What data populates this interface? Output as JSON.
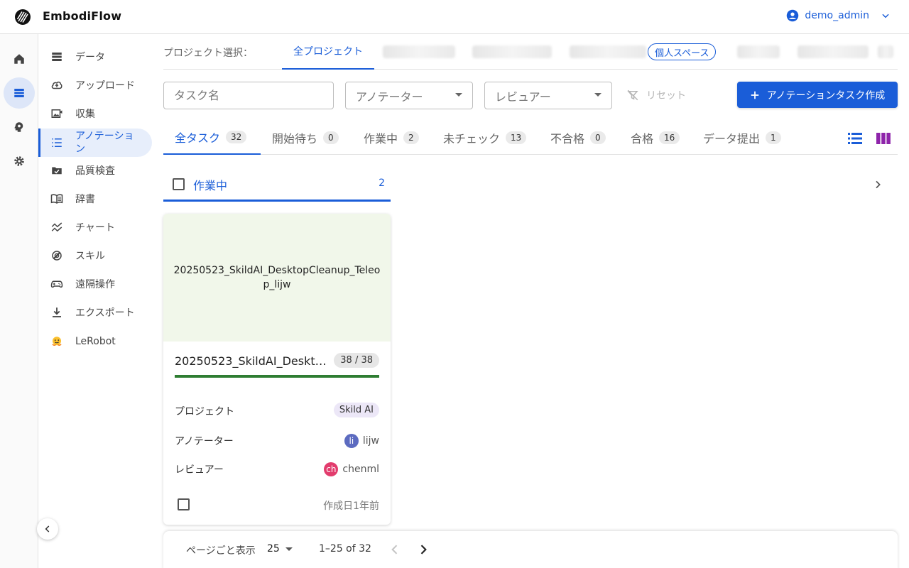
{
  "header": {
    "brand": "EmbodiFlow",
    "user": "demo_admin"
  },
  "sidebar": {
    "items": [
      {
        "label": "データ",
        "icon": "database-icon"
      },
      {
        "label": "アップロード",
        "icon": "cloud-upload-icon"
      },
      {
        "label": "収集",
        "icon": "camera-collect-icon"
      },
      {
        "label": "アノテーション",
        "icon": "list-numbered-icon"
      },
      {
        "label": "品質検査",
        "icon": "quality-check-icon"
      },
      {
        "label": "辞書",
        "icon": "book-icon"
      },
      {
        "label": "チャート",
        "icon": "chart-line-icon"
      },
      {
        "label": "スキル",
        "icon": "skill-icon"
      },
      {
        "label": "遠隔操作",
        "icon": "gamepad-icon"
      },
      {
        "label": "エクスポート",
        "icon": "download-icon"
      },
      {
        "label": "LeRobot",
        "icon": "hugging-face-icon"
      }
    ]
  },
  "project_bar": {
    "label": "プロジェクト選択：",
    "active_tab": "全プロジェクト",
    "personal_chip": "個人スペース"
  },
  "filters": {
    "task_name_placeholder": "タスク名",
    "annotator_placeholder": "アノテーター",
    "reviewer_placeholder": "レビュアー",
    "reset_label": "リセット",
    "create_label": "アノテーションタスク作成"
  },
  "status_tabs": [
    {
      "label": "全タスク",
      "count": "32"
    },
    {
      "label": "開始待ち",
      "count": "0"
    },
    {
      "label": "作業中",
      "count": "2"
    },
    {
      "label": "未チェック",
      "count": "13"
    },
    {
      "label": "不合格",
      "count": "0"
    },
    {
      "label": "合格",
      "count": "16"
    },
    {
      "label": "データ提出",
      "count": "1"
    }
  ],
  "column": {
    "title": "作業中",
    "count": "2"
  },
  "card": {
    "thumb_text": "20250523_SkildAI_DesktopCleanup_Teleop_lijw",
    "title": "20250523_SkildAI_DesktopCleanup_Teleop_lijw",
    "progress_label": "38 / 38",
    "progress_fraction": 1.0,
    "project_label": "プロジェクト",
    "project_value": "Skild AI",
    "annotator_label": "アノテーター",
    "annotator_initials": "li",
    "annotator_name": "lijw",
    "annotator_color": "#5c6bc0",
    "reviewer_label": "レビュアー",
    "reviewer_initials": "ch",
    "reviewer_name": "chenml",
    "reviewer_color": "#e23c6d",
    "created": "作成日1年前"
  },
  "pagination": {
    "per_page_label": "ページごと表示",
    "per_page_value": "25",
    "range": "1–25 of 32"
  },
  "colors": {
    "accent": "#1a5dd8",
    "progress": "#2e7d32"
  }
}
